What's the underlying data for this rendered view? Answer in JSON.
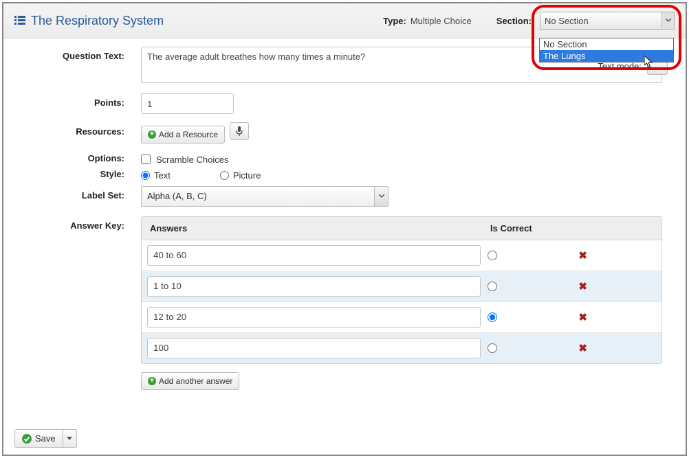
{
  "header": {
    "title": "The Respiratory System",
    "type_label": "Type:",
    "type_value": "Multiple Choice",
    "section_label": "Section:",
    "section_value": "No Section",
    "section_options": [
      "No Section",
      "The Lungs"
    ]
  },
  "text_mode_label": "Text mode:",
  "labels": {
    "question_text": "Question Text:",
    "points": "Points:",
    "resources": "Resources:",
    "options": "Options:",
    "style": "Style:",
    "label_set": "Label Set:",
    "answer_key": "Answer Key:"
  },
  "question_text_value": "The average adult breathes how many times a minute?",
  "points_value": "1",
  "add_resource_label": "Add a Resource",
  "scramble_label": "Scramble Choices",
  "style_text_label": "Text",
  "style_picture_label": "Picture",
  "label_set_value": "Alpha (A, B, C)",
  "table_headers": {
    "answers": "Answers",
    "is_correct": "Is Correct"
  },
  "answers": [
    {
      "text": "40 to 60",
      "correct": false
    },
    {
      "text": "1 to 10",
      "correct": false
    },
    {
      "text": "12 to 20",
      "correct": true
    },
    {
      "text": "100",
      "correct": false
    }
  ],
  "add_another_label": "Add another answer",
  "save_label": "Save"
}
